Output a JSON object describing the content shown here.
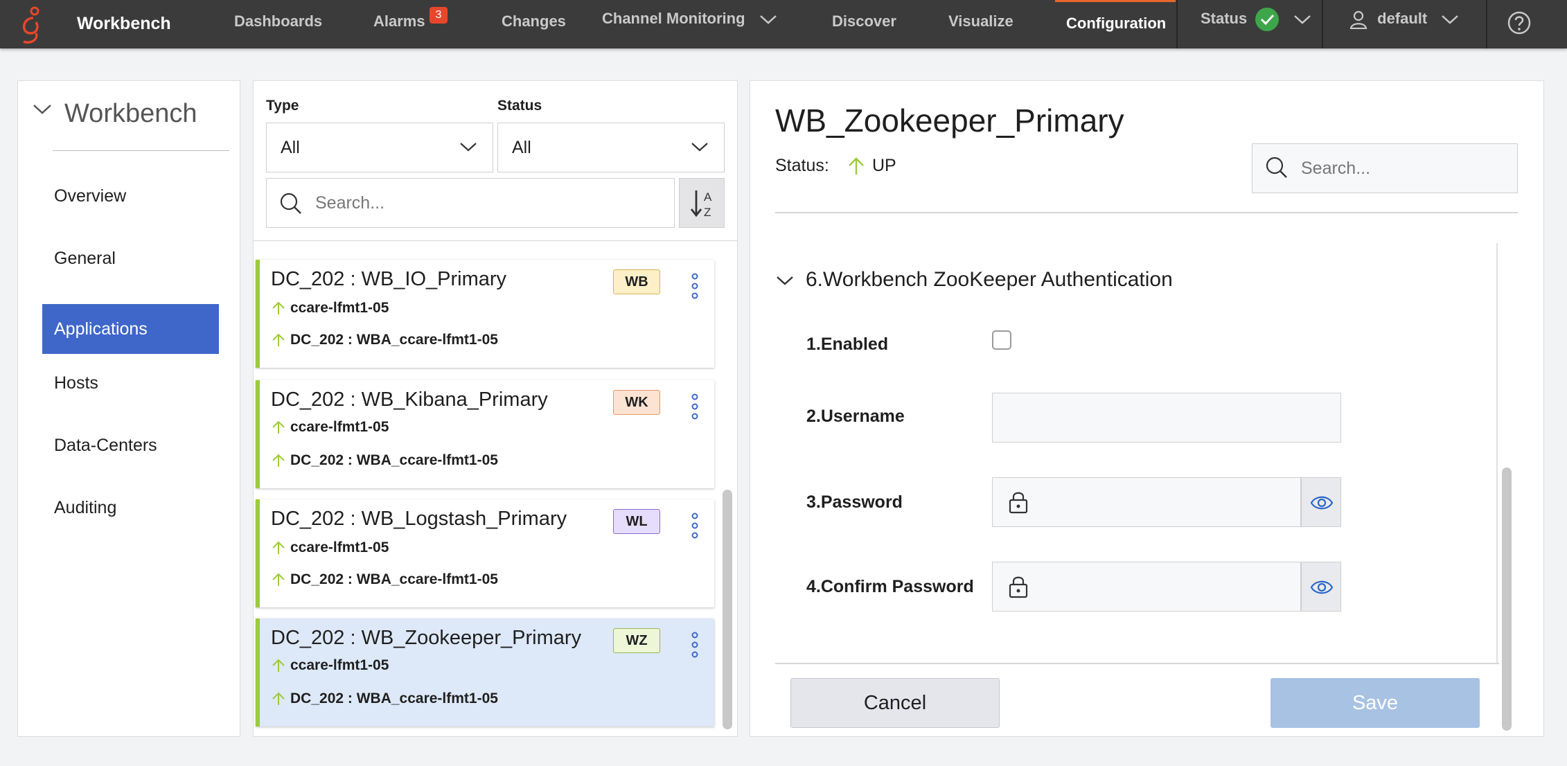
{
  "app": {
    "name": "Workbench"
  },
  "nav": {
    "dashboards": "Dashboards",
    "alarms": "Alarms",
    "alarms_count": "3",
    "changes": "Changes",
    "channel_monitoring": "Channel Monitoring",
    "discover": "Discover",
    "visualize": "Visualize",
    "configuration": "Configuration",
    "status": "Status",
    "user": "default",
    "accent_color": "#e8662b"
  },
  "sidebar": {
    "title": "Workbench",
    "items": [
      {
        "label": "Overview"
      },
      {
        "label": "General"
      },
      {
        "label": "Applications",
        "active": true
      },
      {
        "label": "Hosts"
      },
      {
        "label": "Data-Centers"
      },
      {
        "label": "Auditing"
      }
    ],
    "active_color": "#3f67c9"
  },
  "filters": {
    "type_label": "Type",
    "type_value": "All",
    "status_label": "Status",
    "status_value": "All",
    "search_placeholder": "Search...",
    "sort_icon": "sort-alpha-icon"
  },
  "app_list": [
    {
      "title": "DC_202 : WB_IO_Primary",
      "host": "ccare-lfmt1-05",
      "dc": "DC_202 : WBA_ccare-lfmt1-05",
      "tag": "WB",
      "tag_bg": "#fdf0c8",
      "tag_border": "#d9b44a"
    },
    {
      "title": "DC_202 : WB_Kibana_Primary",
      "host": "ccare-lfmt1-05",
      "dc": "DC_202 : WBA_ccare-lfmt1-05",
      "tag": "WK",
      "tag_bg": "#fde3d2",
      "tag_border": "#e39a6b"
    },
    {
      "title": "DC_202 : WB_Logstash_Primary",
      "host": "ccare-lfmt1-05",
      "dc": "DC_202 : WBA_ccare-lfmt1-05",
      "tag": "WL",
      "tag_bg": "#e6dcfb",
      "tag_border": "#8d6ad6"
    },
    {
      "title": "DC_202 : WB_Zookeeper_Primary",
      "host": "ccare-lfmt1-05",
      "dc": "DC_202 : WBA_ccare-lfmt1-05",
      "tag": "WZ",
      "tag_bg": "#eef6d8",
      "tag_border": "#98b650",
      "selected": true
    }
  ],
  "detail": {
    "title": "WB_Zookeeper_Primary",
    "status_label": "Status:",
    "status_value": "UP",
    "search_placeholder": "Search...",
    "section_title": "6.Workbench ZooKeeper Authentication",
    "fields": {
      "enabled": "1.Enabled",
      "enabled_checked": false,
      "username": "2.Username",
      "username_value": "",
      "password": "3.Password",
      "password_value": "",
      "confirm_password": "4.Confirm Password",
      "confirm_password_value": ""
    },
    "cancel_label": "Cancel",
    "save_label": "Save"
  }
}
